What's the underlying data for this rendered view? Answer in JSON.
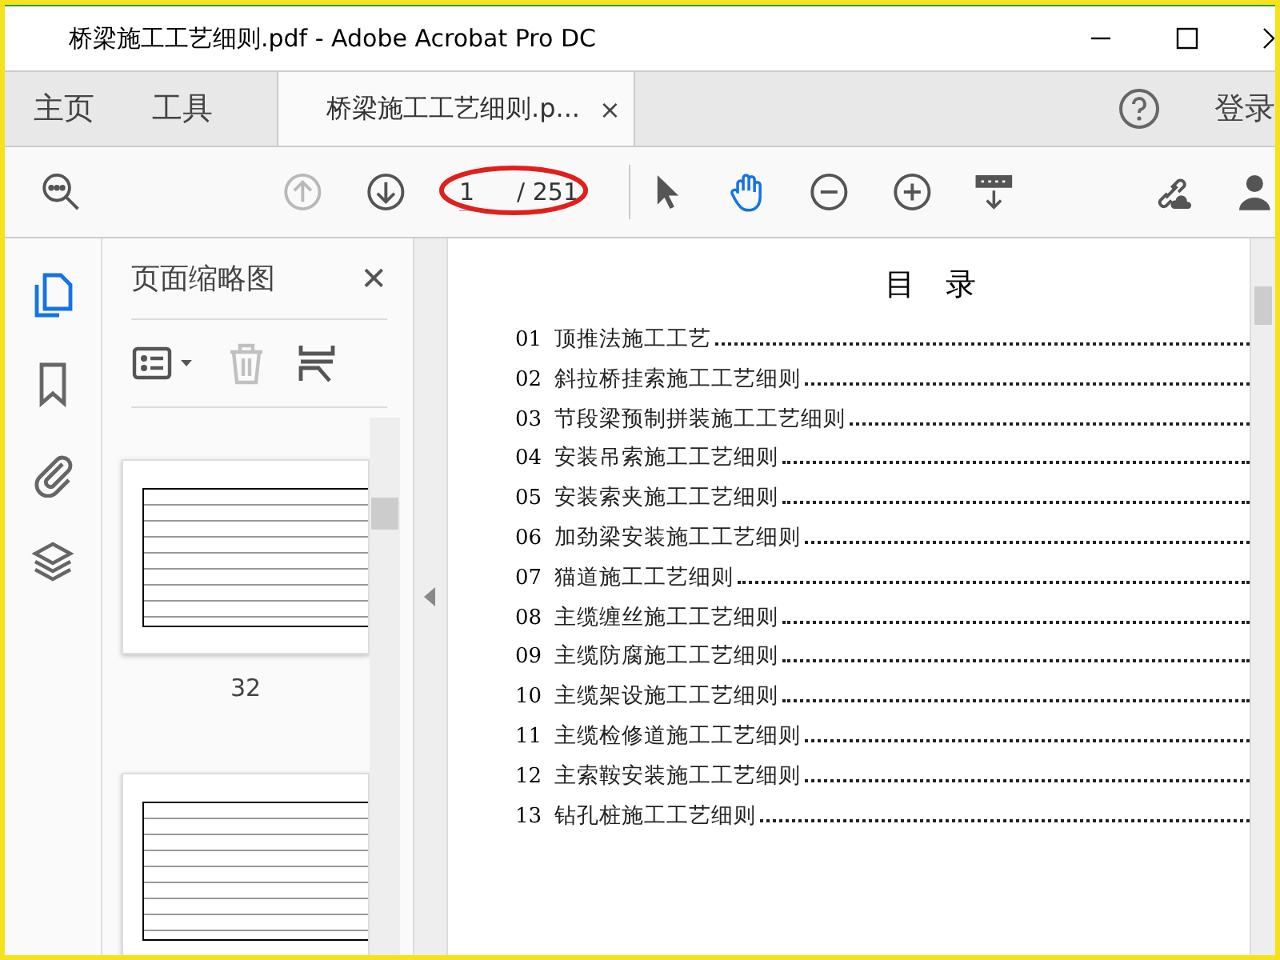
{
  "window": {
    "title": "桥梁施工工艺细则.pdf - Adobe Acrobat Pro DC"
  },
  "tabs": [
    {
      "label": "主页",
      "kind": "nav",
      "selected": false
    },
    {
      "label": "工具",
      "kind": "nav",
      "selected": false
    },
    {
      "label": "桥梁施工工艺细则.p...",
      "kind": "doc",
      "selected": true,
      "close": "×"
    }
  ],
  "sign_in": "登录",
  "toolbar": [
    {
      "kind": "search",
      "disabled": false,
      "selected": false
    },
    {
      "kind": "prev",
      "disabled": true,
      "selected": false
    },
    {
      "kind": "next",
      "disabled": false,
      "selected": false
    },
    {
      "kind": "page",
      "value": "1",
      "total": "/ 251",
      "highlighted": true
    },
    {
      "kind": "select",
      "disabled": false,
      "selected": false
    },
    {
      "kind": "hand",
      "disabled": false,
      "selected": true
    },
    {
      "kind": "zoom-out",
      "disabled": false,
      "selected": false
    },
    {
      "kind": "zoom-in",
      "disabled": false,
      "selected": false
    },
    {
      "kind": "keyboard",
      "disabled": false,
      "selected": false
    },
    {
      "kind": "link",
      "disabled": false,
      "selected": false
    },
    {
      "kind": "user",
      "disabled": false,
      "selected": false
    }
  ],
  "rail": [
    {
      "kind": "pages",
      "selected": true
    },
    {
      "kind": "bookmark",
      "selected": false
    },
    {
      "kind": "clip",
      "selected": false
    },
    {
      "kind": "layers",
      "selected": false
    }
  ],
  "panel": {
    "title": "页面缩略图",
    "close": "✕",
    "tools": [
      {
        "kind": "options",
        "disabled": false
      },
      {
        "kind": "delete",
        "disabled": true
      },
      {
        "kind": "extract",
        "disabled": false
      }
    ],
    "thumbnails": [
      {
        "label": "32",
        "selected": false
      },
      {
        "selected": false
      }
    ]
  },
  "document": {
    "heading": "目　录",
    "entries": [
      {
        "num": "01",
        "title": "顶推法施工工艺"
      },
      {
        "num": "02",
        "title": "斜拉桥挂索施工工艺细则"
      },
      {
        "num": "03",
        "title": "节段梁预制拼装施工工艺细则"
      },
      {
        "num": "04",
        "title": "安装吊索施工工艺细则"
      },
      {
        "num": "05",
        "title": "安装索夹施工工艺细则"
      },
      {
        "num": "06",
        "title": "加劲梁安装施工工艺细则"
      },
      {
        "num": "07",
        "title": "猫道施工工艺细则"
      },
      {
        "num": "08",
        "title": "主缆缠丝施工工艺细则"
      },
      {
        "num": "09",
        "title": "主缆防腐施工工艺细则"
      },
      {
        "num": "10",
        "title": "主缆架设施工工艺细则"
      },
      {
        "num": "11",
        "title": "主缆检修道施工工艺细则"
      },
      {
        "num": "12",
        "title": "主索鞍安装施工工艺细则"
      },
      {
        "num": "13",
        "title": "钻孔桩施工工艺细则"
      }
    ]
  }
}
